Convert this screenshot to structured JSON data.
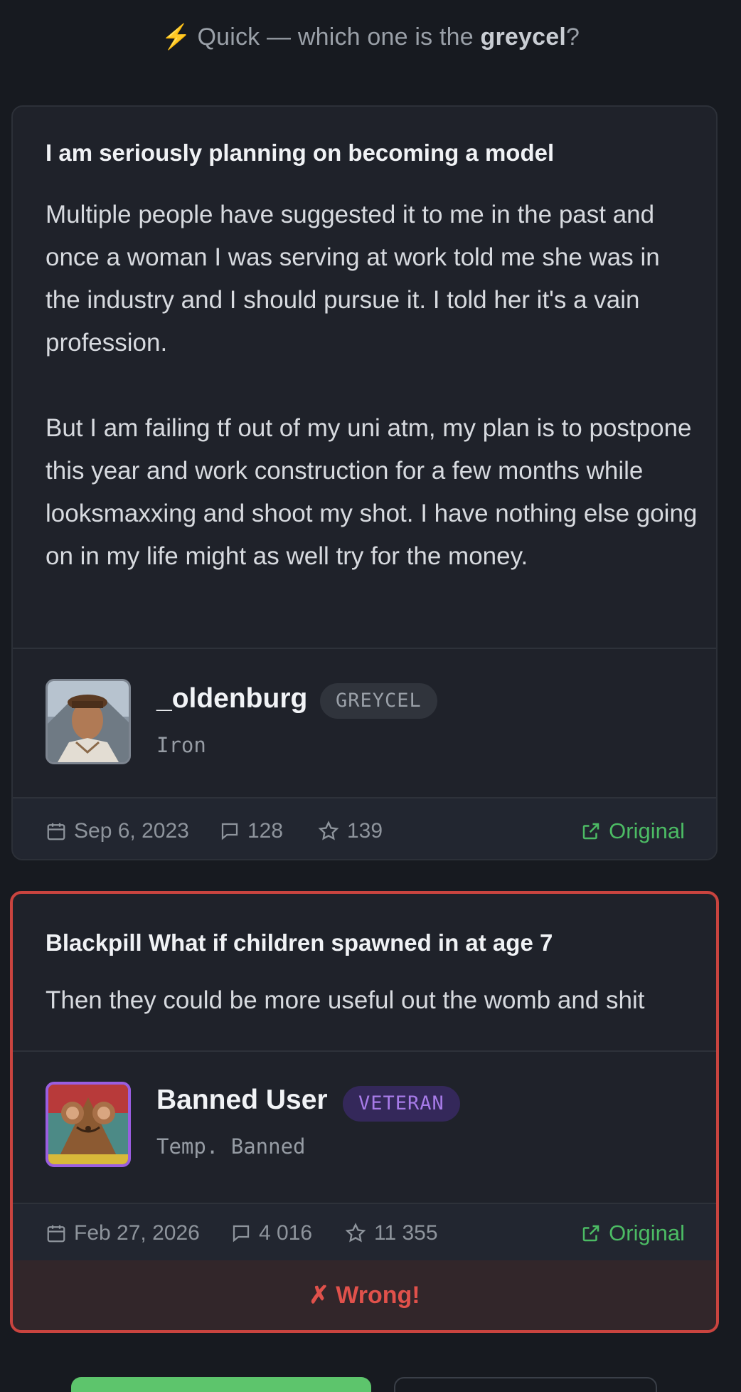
{
  "prompt": {
    "prefix": "Quick — which one is the ",
    "highlight": "greycel",
    "suffix": "?"
  },
  "posts": [
    {
      "title": "I am seriously planning on becoming a model",
      "body": "Multiple people have suggested it to me in the past and once a woman I was serving at work told me she was in the industry and I should pursue it. I told her it's a vain profession.\n\nBut I am failing tf out of my uni atm, my plan is to postpone this year and work construction for a few months while looksmaxxing and shoot my shot. I have nothing else going on in my life might as well try for the money.",
      "username": "_oldenburg",
      "badge": "GREYCEL",
      "rank": "Iron",
      "date": "Sep 6, 2023",
      "comments": "128",
      "stars": "139",
      "original_label": "Original"
    },
    {
      "title": "Blackpill What if children spawned in at age 7",
      "body": "Then they could be more useful out the womb and shit",
      "username": "Banned User",
      "badge": "VETERAN",
      "rank": "Temp. Banned",
      "date": "Feb 27, 2026",
      "comments": "4 016",
      "stars": "11 355",
      "original_label": "Original",
      "verdict": "✗ Wrong!"
    }
  ],
  "colors": {
    "background": "#171a20",
    "card": "#1f222a",
    "accent_green": "#4cbb64",
    "wrong_red": "#c9443f",
    "veteran_purple": "#9a5ee0"
  },
  "icons": [
    "lightning-icon",
    "calendar-icon",
    "comment-icon",
    "star-icon",
    "external-link-icon"
  ]
}
